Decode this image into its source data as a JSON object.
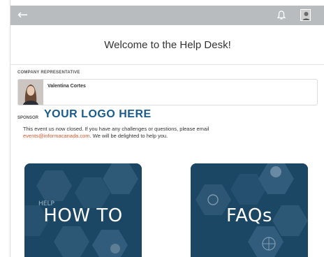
{
  "topbar": {
    "back_icon": "arrow-left-icon",
    "bell_icon": "bell-icon",
    "avatar_icon": "user-avatar"
  },
  "page": {
    "title": "Welcome to the Help Desk!"
  },
  "company_rep": {
    "label": "COMPANY REPRESENTATIVE",
    "name": "Valentina Cortes"
  },
  "sponsor": {
    "label": "SPONSOR",
    "logo_text": "YOUR LOGO HERE"
  },
  "notice": {
    "text_before": "This event us now closed. If you have any challenges or questions, please email",
    "email": "events@informacanada.com",
    "text_after": ". We will be delighted to help you."
  },
  "tiles": [
    {
      "label": "HOW TO"
    },
    {
      "label": "FAQs"
    }
  ],
  "colors": {
    "topbar": "#b9bcbf",
    "logo": "#1a5b8c",
    "email": "#e0572a",
    "tile": "#173f5e"
  }
}
